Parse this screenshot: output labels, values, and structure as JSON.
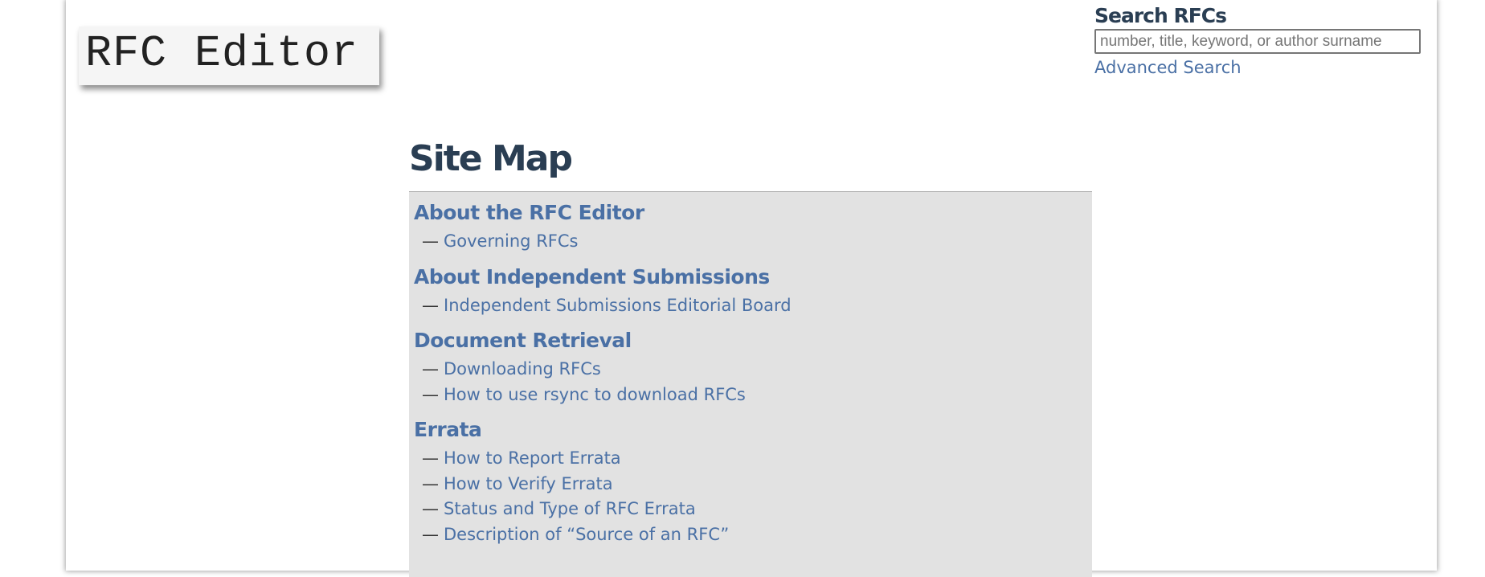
{
  "header": {
    "logo_text": "RFC Editor"
  },
  "search": {
    "title": "Search RFCs",
    "placeholder": "number, title, keyword, or author surname",
    "value": "",
    "advanced_link": "Advanced Search"
  },
  "page_title": "Site Map",
  "sitemap": {
    "dash": "—",
    "sections": [
      {
        "heading": "About the RFC Editor",
        "items": [
          "Governing RFCs"
        ]
      },
      {
        "heading": "About Independent Submissions",
        "items": [
          "Independent Submissions Editorial Board"
        ]
      },
      {
        "heading": "Document Retrieval",
        "items": [
          "Downloading RFCs",
          "How to use rsync to download RFCs"
        ]
      },
      {
        "heading": "Errata",
        "items": [
          "How to Report Errata",
          "How to Verify Errata",
          "Status and Type of RFC Errata",
          "Description of “Source of an RFC”"
        ]
      }
    ]
  },
  "colors": {
    "link": "#4a70a5",
    "heading": "#2a3e53",
    "panel_bg": "#e2e2e2"
  }
}
